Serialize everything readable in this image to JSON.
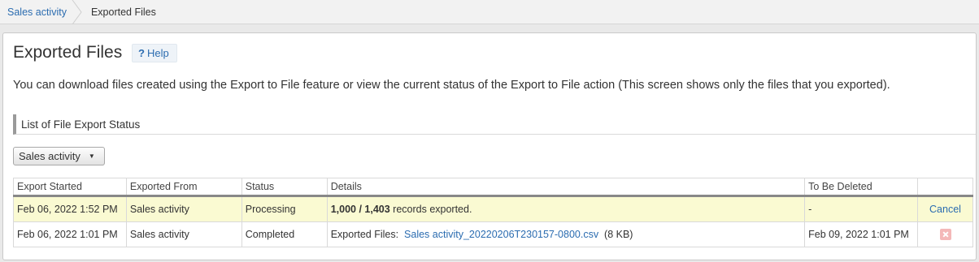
{
  "breadcrumb": {
    "parent": "Sales activity",
    "current": "Exported Files"
  },
  "page": {
    "title": "Exported Files",
    "help_label": "Help",
    "help_icon": "question-icon",
    "description": "You can download files created using the Export to File feature or view the current status of the Export to File action (This screen shows only the files that you exported)."
  },
  "section": {
    "title": "List of File Export Status"
  },
  "filter": {
    "selected": "Sales activity",
    "caret": "▼"
  },
  "table": {
    "columns": [
      "Export Started",
      "Exported From",
      "Status",
      "Details",
      "To Be Deleted",
      ""
    ],
    "rows": [
      {
        "export_started": "Feb 06, 2022 1:52 PM",
        "exported_from": "Sales activity",
        "status": "Processing",
        "details_count": "1,000 / 1,403",
        "details_suffix": " records exported.",
        "to_be_deleted": "-",
        "action": "Cancel"
      },
      {
        "export_started": "Feb 06, 2022 1:01 PM",
        "exported_from": "Sales activity",
        "status": "Completed",
        "details_prefix": "Exported Files:",
        "file_name": "Sales activity_20220206T230157-0800.csv",
        "file_size": "(8 KB)",
        "to_be_deleted": "Feb 09, 2022 1:01 PM",
        "action_icon": "delete-icon"
      }
    ]
  },
  "colors": {
    "link": "#2b6cb0",
    "processing_row": "#fafad2",
    "completed_status": "#3a8a2a",
    "delete_button": "#f4b8b8"
  }
}
